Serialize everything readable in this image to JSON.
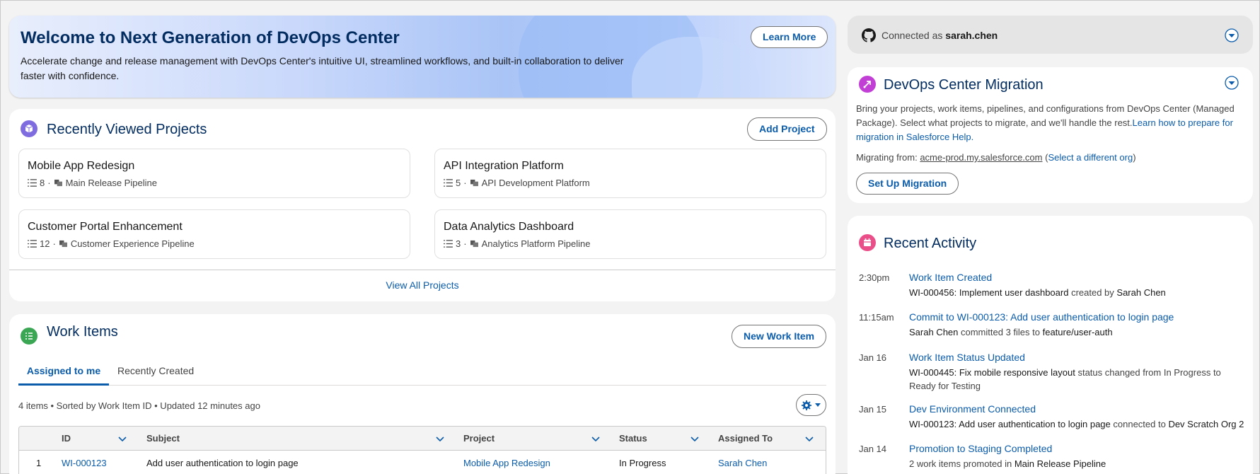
{
  "colors": {
    "brand_blue": "#0b5cab",
    "heading_navy": "#032d60",
    "projects_icon": "#7f6de0",
    "work_items_icon": "#3ba755",
    "migration_icon": "#c23fd6",
    "activity_icon": "#ea4f89"
  },
  "banner": {
    "title": "Welcome to Next Generation of DevOps Center",
    "description": "Accelerate change and release management with DevOps Center's intuitive UI, streamlined workflows, and built-in collaboration to deliver faster with confidence.",
    "learn_more": "Learn More"
  },
  "projects": {
    "title": "Recently Viewed Projects",
    "add_button": "Add Project",
    "view_all": "View All Projects",
    "items": [
      {
        "name": "Mobile App Redesign",
        "count": "8",
        "pipeline": "Main Release Pipeline"
      },
      {
        "name": "API Integration Platform",
        "count": "5",
        "pipeline": "API Development Platform"
      },
      {
        "name": "Customer Portal Enhancement",
        "count": "12",
        "pipeline": "Customer Experience Pipeline"
      },
      {
        "name": "Data Analytics Dashboard",
        "count": "3",
        "pipeline": "Analytics Platform Pipeline"
      }
    ]
  },
  "work_items": {
    "title": "Work Items",
    "new_button": "New Work Item",
    "tabs": [
      "Assigned to me",
      "Recently Created"
    ],
    "summary": "4 items • Sorted by Work Item ID • Updated 12 minutes ago",
    "columns": [
      "ID",
      "Subject",
      "Project",
      "Status",
      "Assigned To"
    ],
    "rows": [
      {
        "num": "1",
        "id": "WI-000123",
        "subject": "Add user authentication to login page",
        "project": "Mobile App Redesign",
        "status": "In Progress",
        "assigned": "Sarah Chen"
      }
    ]
  },
  "github": {
    "prefix": "Connected as",
    "user": "sarah.chen"
  },
  "migration": {
    "title": "DevOps Center Migration",
    "description": "Bring your projects, work items, pipelines, and configurations from DevOps Center (Managed Package). Select what projects to migrate, and we'll handle the rest.",
    "learn_link": "Learn how to prepare for migration in Salesforce Help.",
    "from_label": "Migrating from:",
    "from_org": "acme-prod.my.salesforce.com",
    "paren_open": "(",
    "select_org": "Select a different org",
    "paren_close": ")",
    "setup_button": "Set Up Migration"
  },
  "activity": {
    "title": "Recent Activity",
    "items": [
      {
        "time": "2:30pm",
        "title": "Work Item Created",
        "p1": "WI-000456: Implement user dashboard",
        "p2": " created by ",
        "p3": "Sarah Chen"
      },
      {
        "time": "11:15am",
        "title": "Commit to WI-000123: Add user authentication to login page",
        "p1": "Sarah Chen",
        "p2": " committed 3 files to ",
        "p3": "feature/user-auth"
      },
      {
        "time": "Jan 16",
        "title": "Work Item Status Updated",
        "p1": "WI-000445: Fix mobile responsive layout",
        "p2": " status changed from In Progress to Ready for Testing",
        "p3": ""
      },
      {
        "time": "Jan 15",
        "title": "Dev Environment Connected",
        "p1": "WI-000123: Add user authentication to login page",
        "p2": " connected to ",
        "p3": "Dev Scratch Org 2"
      },
      {
        "time": "Jan 14",
        "title": "Promotion to Staging Completed",
        "p1": "2 work items promoted in ",
        "p2": "Main Release Pipeline",
        "p3": ""
      }
    ]
  }
}
